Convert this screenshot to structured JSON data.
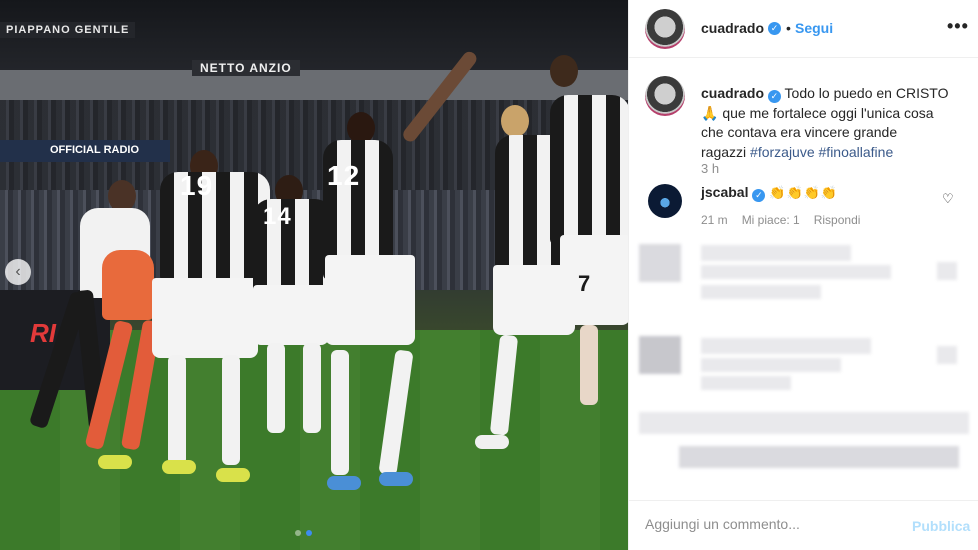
{
  "photo": {
    "banner_left": "PIAPPANO GENTILE",
    "banner_mid": "NETTO ANZIO",
    "ad_top": "OFFICIAL RADIO",
    "ad_board": "RI",
    "player_numbers": [
      "19",
      "14",
      "12",
      "7"
    ],
    "nav_prev_icon": "‹"
  },
  "post": {
    "username": "cuadrado",
    "follow_label": "Segui",
    "separator": "•",
    "more_icon": "•••"
  },
  "caption": {
    "username": "cuadrado",
    "text_line1": " Todo lo puedo en CRISTO",
    "text_line2": " que me fortalece oggi l'unica cosa",
    "text_line3": "che contava era vincere grande",
    "text_line4": "ragazzi ",
    "hashtag1": "#forzajuve",
    "hashtag2": "#finoallafine",
    "time": "3 h"
  },
  "comment": {
    "username": "jscabal",
    "emoji": "👏👏👏👏",
    "time": "21 m",
    "likes": "Mi piace: 1",
    "reply": "Rispondi"
  },
  "add_comment": {
    "placeholder": "Aggiungi un commento...",
    "publish_label": "Pubblica"
  }
}
